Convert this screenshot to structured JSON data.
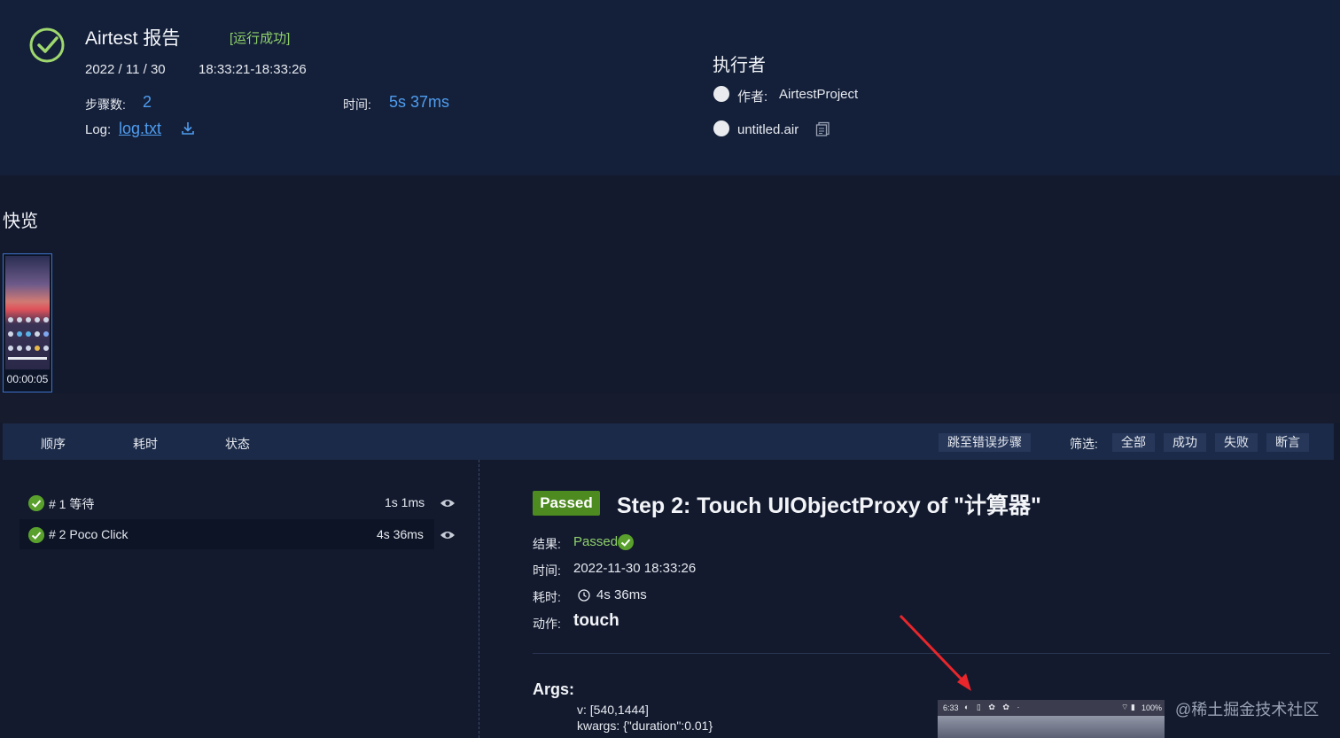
{
  "header": {
    "title": "Airtest 报告",
    "status": "[运行成功]",
    "date": "2022 / 11 / 30",
    "time_range": "18:33:21-18:33:26",
    "steps_label": "步骤数:",
    "steps_value": "2",
    "duration_label": "时间:",
    "duration_value": "5s 37ms",
    "log_label": "Log:",
    "log_file": "log.txt",
    "executor_title": "执行者",
    "author_label": "作者:",
    "author_value": "AirtestProject",
    "script_name": "untitled.air"
  },
  "quick_view": {
    "title": "快览",
    "thumb_time": "00:00:05"
  },
  "toolbar": {
    "col_order": "顺序",
    "col_time": "耗时",
    "col_status": "状态",
    "jump_error": "跳至错误步骤",
    "filter_label": "筛选:",
    "filters": [
      "全部",
      "成功",
      "失败",
      "断言"
    ]
  },
  "steps": [
    {
      "name": "# 1 等待",
      "time": "1s 1ms"
    },
    {
      "name": "# 2 Poco Click",
      "time": "4s 36ms"
    }
  ],
  "detail": {
    "badge": "Passed",
    "title": "Step 2: Touch UIObjectProxy of \"计算器\"",
    "result_label": "结果:",
    "result_value": "Passed",
    "time_label": "时间:",
    "time_value": "2022-11-30 18:33:26",
    "duration_label": "耗时:",
    "duration_value": "4s 36ms",
    "action_label": "动作:",
    "action_value": "touch",
    "args_title": "Args:",
    "args": [
      "v: [540,1444]",
      "kwargs: {\"duration\":0.01}"
    ],
    "screenshot_status_time": "6:33",
    "screenshot_battery": "100%"
  },
  "watermark": "@稀土掘金技术社区",
  "colors": {
    "accent": "#4f9df0",
    "success": "#5aa02c",
    "background": "#131a2e"
  }
}
